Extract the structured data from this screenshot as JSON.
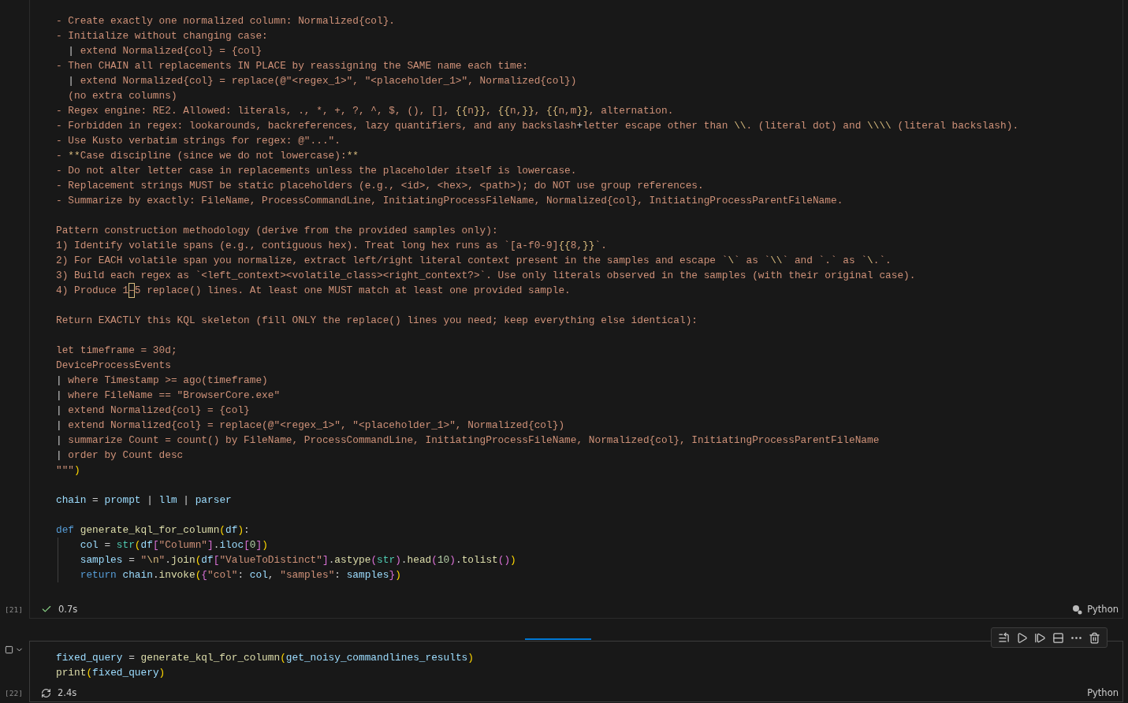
{
  "cells": [
    {
      "execution_count": "[21]",
      "kind": "done",
      "duration": "0.7s",
      "language": "Python",
      "selected": false,
      "blocks": [
        [
          [
            {
              "kind": "s",
              "text": "- Create exactly one normalized column: Normalized{col}."
            }
          ],
          [
            {
              "kind": "s",
              "text": "- Initialize without changing case:"
            }
          ],
          [
            {
              "kind": "p",
              "text": "  |"
            },
            {
              "kind": "s",
              "text": " extend Normalized{col} = {col}"
            }
          ],
          [
            {
              "kind": "s",
              "text": "- Then CHAIN all replacements IN PLACE by reassigning the SAME name each time:"
            }
          ],
          [
            {
              "kind": "p",
              "text": "  |"
            },
            {
              "kind": "s",
              "text": " extend Normalized{col} = replace(@\"<regex_1>\", \"<placeholder_1>\", Normalized{col})"
            }
          ],
          [
            {
              "kind": "s",
              "text": "  (no extra columns)"
            }
          ],
          [
            {
              "kind": "s",
              "text": "- Regex engine: RE2. Allowed: literals, ., *, +, ?, ^, $, (), [], "
            },
            {
              "kind": "e",
              "text": "{{"
            },
            {
              "kind": "s",
              "text": "n"
            },
            {
              "kind": "e",
              "text": "}}"
            },
            {
              "kind": "s",
              "text": ", "
            },
            {
              "kind": "e",
              "text": "{{"
            },
            {
              "kind": "s",
              "text": "n,"
            },
            {
              "kind": "e",
              "text": "}}"
            },
            {
              "kind": "s",
              "text": ", "
            },
            {
              "kind": "e",
              "text": "{{"
            },
            {
              "kind": "s",
              "text": "n,m"
            },
            {
              "kind": "e",
              "text": "}}"
            },
            {
              "kind": "s",
              "text": ", alternation."
            }
          ],
          [
            {
              "kind": "s",
              "text": "- Forbidden in regex: lookarounds, backreferences, lazy quantifiers, and any backslash"
            },
            {
              "kind": "p",
              "text": "+"
            },
            {
              "kind": "s",
              "text": "letter escape other than "
            },
            {
              "kind": "e",
              "text": "\\\\"
            },
            {
              "kind": "s",
              "text": ". (literal dot) and "
            },
            {
              "kind": "e",
              "text": "\\\\\\\\"
            },
            {
              "kind": "s",
              "text": " (literal backslash)."
            }
          ],
          [
            {
              "kind": "s",
              "text": "- Use Kusto verbatim strings for regex: @\"...\"."
            }
          ],
          [
            {
              "kind": "s",
              "text": "- "
            },
            {
              "kind": "e",
              "text": "**"
            },
            {
              "kind": "s",
              "text": "Case discipline (since we do not lowercase):"
            },
            {
              "kind": "e",
              "text": "**"
            }
          ],
          [
            {
              "kind": "s",
              "text": "- Do not alter letter case in replacements unless the placeholder itself is lowercase."
            }
          ],
          [
            {
              "kind": "s",
              "text": "- Replacement strings MUST be static placeholders (e.g., <id>, <hex>, <path>); do NOT use group references."
            }
          ],
          [
            {
              "kind": "s",
              "text": "- Summarize by exactly: FileName, ProcessCommandLine, InitiatingProcessFileName, Normalized{col}, InitiatingProcessParentFileName."
            }
          ]
        ],
        [
          [
            {
              "kind": "s",
              "text": "Pattern construction methodology (derive from the provided samples only):"
            }
          ],
          [
            {
              "kind": "s",
              "text": "1) Identify volatile spans (e.g., contiguous hex). Treat long hex runs as `[a-f0-9]"
            },
            {
              "kind": "e",
              "text": "{{"
            },
            {
              "kind": "s",
              "text": "8,"
            },
            {
              "kind": "e",
              "text": "}}"
            },
            {
              "kind": "s",
              "text": "`."
            }
          ],
          [
            {
              "kind": "s",
              "text": "2) For EACH volatile span you normalize, extract left/right literal context present in the samples and escape `"
            },
            {
              "kind": "e",
              "text": "\\"
            },
            {
              "kind": "s",
              "text": "` as `"
            },
            {
              "kind": "e",
              "text": "\\\\"
            },
            {
              "kind": "s",
              "text": "` and `.` as `"
            },
            {
              "kind": "e",
              "text": "\\"
            },
            {
              "kind": "s",
              "text": ".`."
            }
          ],
          [
            {
              "kind": "s",
              "text": "3) Build each regex as `<left_context><volatile_class><right_context?>`. Use only literals observed in the samples (with their original case)."
            }
          ],
          [
            {
              "kind": "s",
              "text": "4) Produce 1"
            },
            {
              "kind": "u",
              "text": "–"
            },
            {
              "kind": "s",
              "text": "5 replace() lines. At least one MUST match at least one provided sample."
            }
          ]
        ],
        [
          [
            {
              "kind": "s",
              "text": "Return EXACTLY this KQL skeleton (fill ONLY the replace() lines you need; keep everything else identical):"
            }
          ]
        ],
        [
          [
            {
              "kind": "s",
              "text": "let timeframe = 30d;"
            }
          ],
          [
            {
              "kind": "s",
              "text": "DeviceProcessEvents"
            }
          ],
          [
            {
              "kind": "p",
              "text": "|"
            },
            {
              "kind": "s",
              "text": " where Timestamp >= ago(timeframe)"
            }
          ],
          [
            {
              "kind": "p",
              "text": "|"
            },
            {
              "kind": "s",
              "text": " where FileName == \"BrowserCore.exe\""
            }
          ],
          [
            {
              "kind": "p",
              "text": "|"
            },
            {
              "kind": "s",
              "text": " extend Normalized{col} = {col}"
            }
          ],
          [
            {
              "kind": "p",
              "text": "|"
            },
            {
              "kind": "s",
              "text": " extend Normalized{col} = replace(@\"<regex_1>\", \"<placeholder_1>\", Normalized{col})"
            }
          ],
          [
            {
              "kind": "p",
              "text": "|"
            },
            {
              "kind": "s",
              "text": " summarize Count = count() by FileName, ProcessCommandLine, InitiatingProcessFileName, Normalized{col}, InitiatingProcessParentFileName"
            }
          ],
          [
            {
              "kind": "p",
              "text": "|"
            },
            {
              "kind": "s",
              "text": " order by Count desc"
            }
          ],
          [
            {
              "kind": "s",
              "text": "\"\"\""
            },
            {
              "kind": "b",
              "text": ")"
            }
          ]
        ],
        [
          [
            {
              "kind": "v",
              "text": "chain"
            },
            {
              "kind": "p",
              "text": " = "
            },
            {
              "kind": "v",
              "text": "prompt"
            },
            {
              "kind": "p",
              "text": " | "
            },
            {
              "kind": "v",
              "text": "llm"
            },
            {
              "kind": "p",
              "text": " | "
            },
            {
              "kind": "v",
              "text": "parser"
            }
          ]
        ],
        [
          [
            {
              "kind": "k",
              "text": "def "
            },
            {
              "kind": "f",
              "text": "generate_kql_for_column"
            },
            {
              "kind": "b",
              "text": "("
            },
            {
              "kind": "v",
              "text": "df"
            },
            {
              "kind": "b",
              "text": ")"
            },
            {
              "kind": "p",
              "text": ":"
            }
          ],
          [
            {
              "kind": "v",
              "text": "    col"
            },
            {
              "kind": "p",
              "text": " = "
            },
            {
              "kind": "c",
              "text": "str"
            },
            {
              "kind": "b",
              "text": "("
            },
            {
              "kind": "v",
              "text": "df"
            },
            {
              "kind": "m",
              "text": "["
            },
            {
              "kind": "s",
              "text": "\"Column\""
            },
            {
              "kind": "m",
              "text": "]"
            },
            {
              "kind": "p",
              "text": "."
            },
            {
              "kind": "v",
              "text": "iloc"
            },
            {
              "kind": "m",
              "text": "["
            },
            {
              "kind": "n",
              "text": "0"
            },
            {
              "kind": "m",
              "text": "]"
            },
            {
              "kind": "b",
              "text": ")"
            }
          ],
          [
            {
              "kind": "v",
              "text": "    samples"
            },
            {
              "kind": "p",
              "text": " = "
            },
            {
              "kind": "s",
              "text": "\""
            },
            {
              "kind": "e",
              "text": "\\n"
            },
            {
              "kind": "s",
              "text": "\""
            },
            {
              "kind": "p",
              "text": "."
            },
            {
              "kind": "f",
              "text": "join"
            },
            {
              "kind": "b",
              "text": "("
            },
            {
              "kind": "v",
              "text": "df"
            },
            {
              "kind": "m",
              "text": "["
            },
            {
              "kind": "s",
              "text": "\"ValueToDistinct\""
            },
            {
              "kind": "m",
              "text": "]"
            },
            {
              "kind": "p",
              "text": "."
            },
            {
              "kind": "f",
              "text": "astype"
            },
            {
              "kind": "m",
              "text": "("
            },
            {
              "kind": "c",
              "text": "str"
            },
            {
              "kind": "m",
              "text": ")"
            },
            {
              "kind": "p",
              "text": "."
            },
            {
              "kind": "f",
              "text": "head"
            },
            {
              "kind": "m",
              "text": "("
            },
            {
              "kind": "n",
              "text": "10"
            },
            {
              "kind": "m",
              "text": ")"
            },
            {
              "kind": "p",
              "text": "."
            },
            {
              "kind": "f",
              "text": "tolist"
            },
            {
              "kind": "m",
              "text": "()"
            },
            {
              "kind": "b",
              "text": ")"
            }
          ],
          [
            {
              "kind": "k",
              "text": "    return "
            },
            {
              "kind": "v",
              "text": "chain"
            },
            {
              "kind": "p",
              "text": "."
            },
            {
              "kind": "f",
              "text": "invoke"
            },
            {
              "kind": "b",
              "text": "("
            },
            {
              "kind": "m",
              "text": "{"
            },
            {
              "kind": "s",
              "text": "\"col\""
            },
            {
              "kind": "p",
              "text": ": "
            },
            {
              "kind": "v",
              "text": "col"
            },
            {
              "kind": "p",
              "text": ", "
            },
            {
              "kind": "s",
              "text": "\"samples\""
            },
            {
              "kind": "p",
              "text": ": "
            },
            {
              "kind": "v",
              "text": "samples"
            },
            {
              "kind": "m",
              "text": "}"
            },
            {
              "kind": "b",
              "text": ")"
            }
          ]
        ]
      ]
    },
    {
      "execution_count": "[22]",
      "kind": "running",
      "duration": "2.4s",
      "language": "Python",
      "selected": true,
      "blocks": [
        [
          [
            {
              "kind": "v",
              "text": "fixed_query"
            },
            {
              "kind": "p",
              "text": " = "
            },
            {
              "kind": "f",
              "text": "generate_kql_for_column"
            },
            {
              "kind": "b",
              "text": "("
            },
            {
              "kind": "v",
              "text": "get_noisy_commandlines_results"
            },
            {
              "kind": "b",
              "text": ")"
            }
          ],
          [
            {
              "kind": "f",
              "text": "print"
            },
            {
              "kind": "b",
              "text": "("
            },
            {
              "kind": "v",
              "text": "fixed_query"
            },
            {
              "kind": "b",
              "text": ")"
            }
          ]
        ]
      ]
    }
  ]
}
